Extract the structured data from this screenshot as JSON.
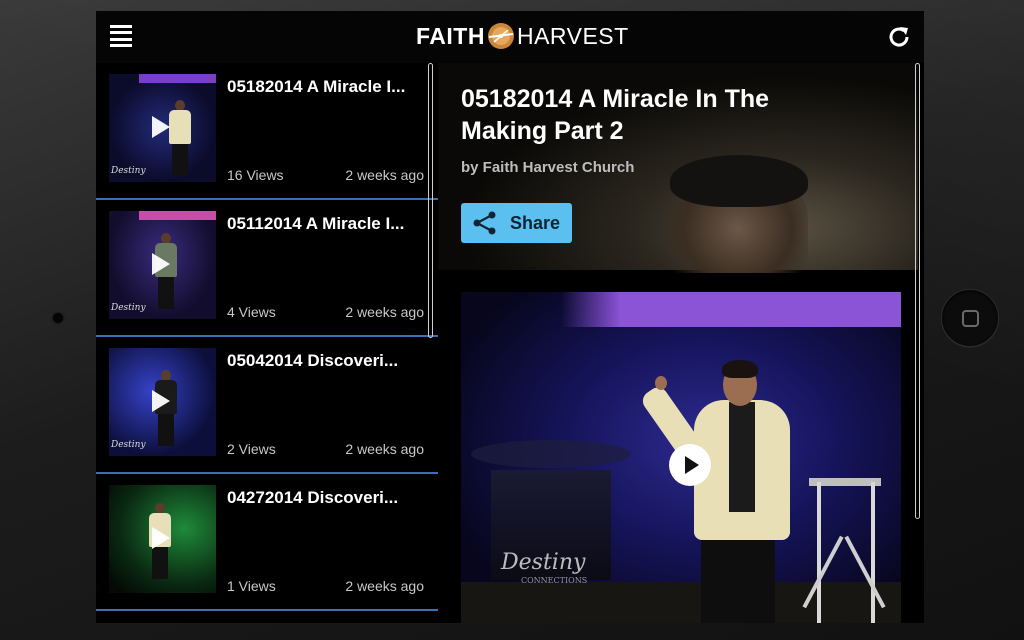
{
  "header": {
    "logo_left": "FAITH",
    "logo_right": "HARVEST",
    "menu_icon": "hamburger-menu-icon",
    "refresh_icon": "refresh-icon"
  },
  "videos": [
    {
      "title": "05182014 A Miracle I...",
      "views": "16 Views",
      "age": "2 weeks ago"
    },
    {
      "title": "05112014 A Miracle I...",
      "views": "4 Views",
      "age": "2 weeks ago"
    },
    {
      "title": "05042014 Discoveri...",
      "views": "2 Views",
      "age": "2 weeks ago"
    },
    {
      "title": "04272014  Discoveri...",
      "views": "1 Views",
      "age": "2 weeks ago"
    }
  ],
  "detail": {
    "title": "05182014 A Miracle In The Making Part 2",
    "author": "by Faith Harvest Church",
    "share_label": "Share",
    "watermark": "Destiny",
    "watermark_sub": "CONNECTIONS"
  },
  "colors": {
    "accent": "#5bc0ef",
    "divider": "#3d6fb5",
    "stage_purple": "#8b53d6"
  }
}
